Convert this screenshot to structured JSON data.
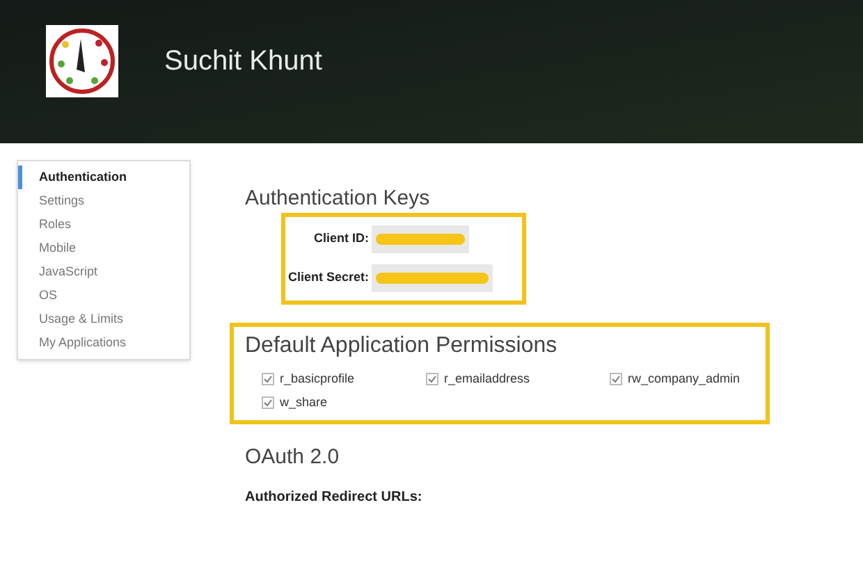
{
  "header": {
    "user_name": "Suchit Khunt"
  },
  "sidebar": {
    "items": [
      {
        "label": "Authentication",
        "selected": true
      },
      {
        "label": "Settings",
        "selected": false
      },
      {
        "label": "Roles",
        "selected": false
      },
      {
        "label": "Mobile",
        "selected": false
      },
      {
        "label": "JavaScript",
        "selected": false
      },
      {
        "label": "OS",
        "selected": false
      },
      {
        "label": "Usage & Limits",
        "selected": false
      },
      {
        "label": "My Applications",
        "selected": false
      }
    ]
  },
  "authentication_keys": {
    "title": "Authentication Keys",
    "fields": [
      {
        "label": "Client ID:"
      },
      {
        "label": "Client Secret:"
      }
    ]
  },
  "permissions": {
    "title": "Default Application Permissions",
    "items": [
      {
        "label": "r_basicprofile",
        "checked": true
      },
      {
        "label": "r_emailaddress",
        "checked": true
      },
      {
        "label": "rw_company_admin",
        "checked": true
      },
      {
        "label": "w_share",
        "checked": true
      }
    ]
  },
  "oauth": {
    "title": "OAuth 2.0",
    "label": "Authorized Redirect URLs:"
  }
}
